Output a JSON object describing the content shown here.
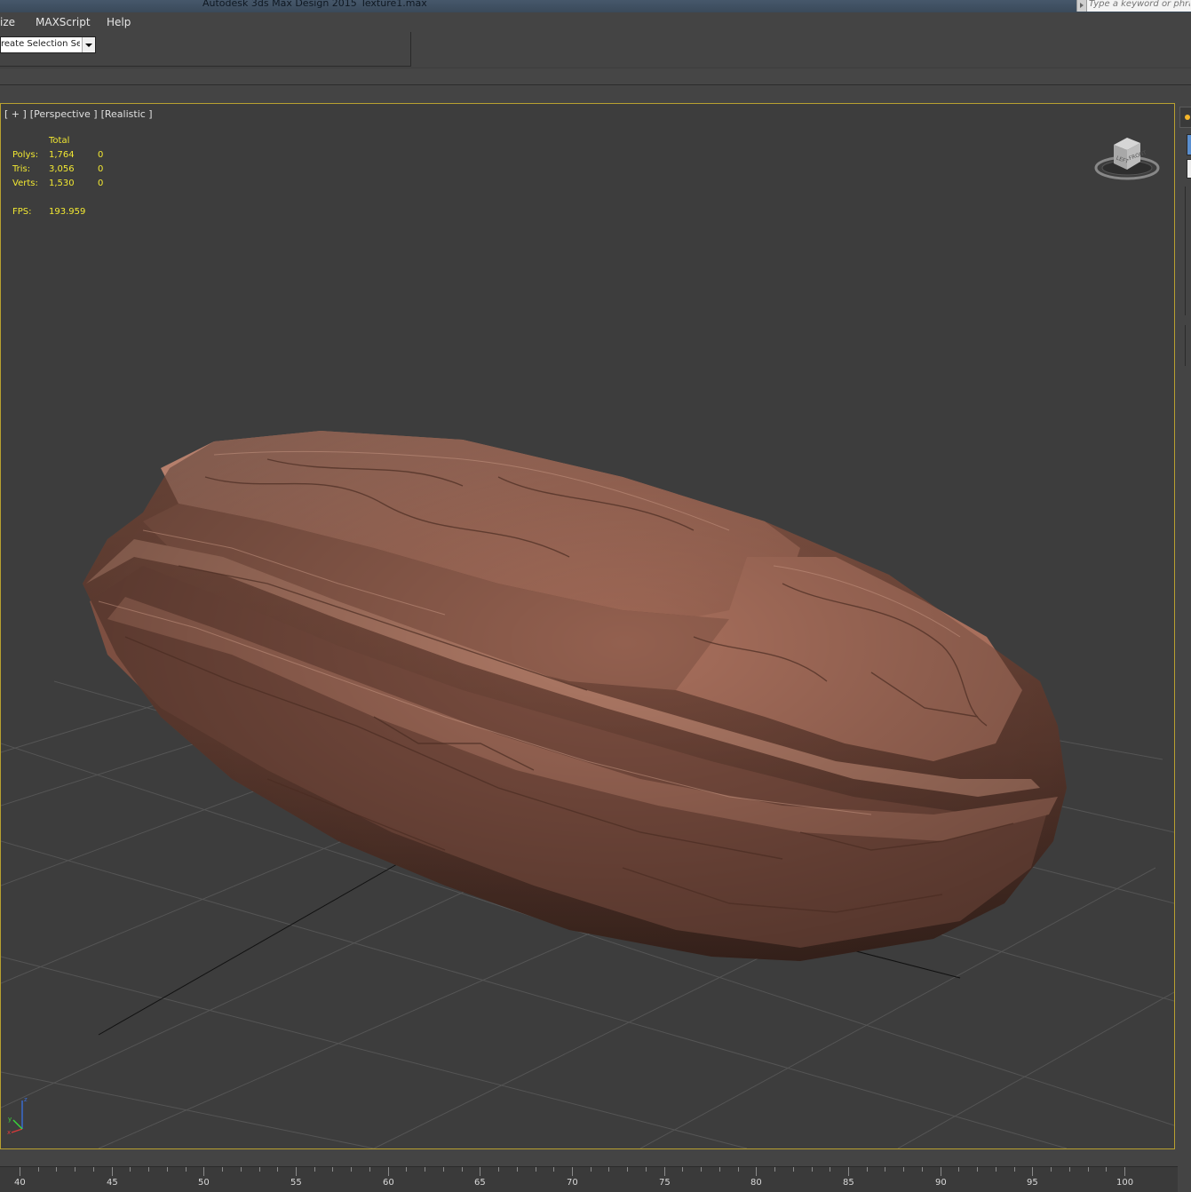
{
  "titlebar": {
    "app_title": "Autodesk 3ds Max Design 2015",
    "file_name": "Texture1.max"
  },
  "search": {
    "placeholder": "Type a keyword or phrase"
  },
  "menu": {
    "items": [
      "ize",
      "MAXScript",
      "Help"
    ]
  },
  "toolbar": {
    "selection_set": "Create Selection Se"
  },
  "viewport": {
    "labels": [
      "[ + ]",
      "[Perspective ]",
      "[Realistic ]"
    ],
    "stats": {
      "header": "Total",
      "rows": [
        {
          "label": "Polys:",
          "total": "1,764",
          "selected": "0"
        },
        {
          "label": "Tris:",
          "total": "3,056",
          "selected": "0"
        },
        {
          "label": "Verts:",
          "total": "1,530",
          "selected": "0"
        }
      ],
      "fps_label": "FPS:",
      "fps_value": "193.959"
    },
    "viewcube": {
      "left_face": "LEFT",
      "front_face": "FRONT"
    },
    "axis_tripod": {
      "z": "z",
      "x": "x",
      "y": "y"
    }
  },
  "colors": {
    "viewport_border": "#b8a030",
    "stats_text": "#f2e832",
    "viewport_background": "#3d3d3d",
    "rock_base": "#a5705e"
  },
  "timeline": {
    "ticks": [
      "40",
      "45",
      "50",
      "55",
      "60",
      "65",
      "70",
      "75",
      "80",
      "85",
      "90",
      "95",
      "100"
    ]
  }
}
